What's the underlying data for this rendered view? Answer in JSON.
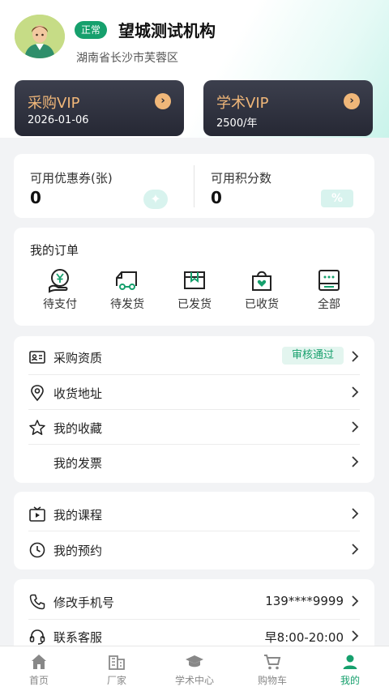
{
  "profile": {
    "status_badge": "正常",
    "org_name": "望城测试机构",
    "location": "湖南省长沙市芙蓉区"
  },
  "vip": {
    "purchase": {
      "title": "采购VIP",
      "sub": "2026-01-06"
    },
    "academic": {
      "title": "学术VIP",
      "sub": "2500/年"
    }
  },
  "stats": {
    "coupons": {
      "label": "可用优惠券(张)",
      "value": "0"
    },
    "points": {
      "label": "可用积分数",
      "value": "0",
      "deco": "%"
    }
  },
  "orders": {
    "title": "我的订单",
    "items": [
      {
        "label": "待支付",
        "icon": "wallet-yen-icon"
      },
      {
        "label": "待发货",
        "icon": "truck-icon"
      },
      {
        "label": "已发货",
        "icon": "box-icon"
      },
      {
        "label": "已收货",
        "icon": "bag-heart-icon"
      },
      {
        "label": "全部",
        "icon": "list-icon"
      }
    ]
  },
  "menu1": [
    {
      "label": "采购资质",
      "icon": "id-card-icon",
      "status": "审核通过"
    },
    {
      "label": "收货地址",
      "icon": "location-pin-icon"
    },
    {
      "label": "我的收藏",
      "icon": "star-icon"
    },
    {
      "label": "我的发票"
    }
  ],
  "menu2": [
    {
      "label": "我的课程",
      "icon": "video-icon"
    },
    {
      "label": "我的预约",
      "icon": "clock-icon"
    }
  ],
  "menu3": [
    {
      "label": "修改手机号",
      "icon": "phone-icon",
      "value": "139****9999"
    },
    {
      "label": "联系客服",
      "icon": "headset-icon",
      "value": "早8:00-20:00"
    }
  ],
  "tabbar": [
    {
      "label": "首页",
      "icon": "home-icon",
      "active": false
    },
    {
      "label": "厂家",
      "icon": "building-icon",
      "active": false
    },
    {
      "label": "学术中心",
      "icon": "graduation-cap-icon",
      "active": false
    },
    {
      "label": "购物车",
      "icon": "cart-icon",
      "active": false
    },
    {
      "label": "我的",
      "icon": "user-icon",
      "active": true
    }
  ],
  "colors": {
    "accent": "#16a06d",
    "vip_gold": "#f0b779",
    "vip_dark": "#2b2d38"
  }
}
